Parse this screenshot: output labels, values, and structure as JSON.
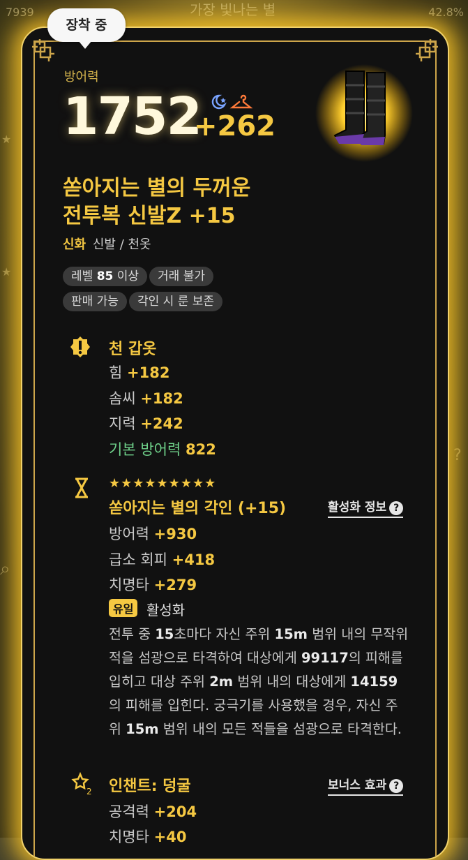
{
  "background": {
    "top_left": "7939",
    "top_center": "가장 빛나는 별",
    "top_right": "42.8%"
  },
  "tag": "장착 중",
  "defense": {
    "label": "방어력",
    "value": "1752",
    "bonus": "+262"
  },
  "item": {
    "name_line1": "쏟아지는 별의 두꺼운",
    "name_line2": "전투복 신발Z +15",
    "grade": "신화",
    "type": "신발 / 천옷",
    "chips": [
      {
        "prefix": "레벨 ",
        "bold": "85",
        "suffix": " 이상"
      },
      {
        "prefix": "거래 불가",
        "bold": "",
        "suffix": ""
      },
      {
        "prefix": "판매 가능",
        "bold": "",
        "suffix": ""
      },
      {
        "prefix": "각인 시 룬 보존",
        "bold": "",
        "suffix": ""
      }
    ]
  },
  "base_section": {
    "title": "천 갑옷",
    "stats": [
      {
        "name": "힘",
        "value": "+182"
      },
      {
        "name": "솜씨",
        "value": "+182"
      },
      {
        "name": "지력",
        "value": "+242"
      },
      {
        "name": "기본 방어력",
        "value": "822"
      }
    ]
  },
  "engrave_section": {
    "stars": "★★★★★★★★★",
    "title": "쏟아지는 별의 각인 (+15)",
    "link": "활성화 정보",
    "stats": [
      {
        "name": "방어력",
        "value": "+930"
      },
      {
        "name": "급소 회피",
        "value": "+418"
      },
      {
        "name": "치명타",
        "value": "+279"
      }
    ],
    "unique_badge": "유일",
    "unique_label": "활성화",
    "description": [
      {
        "t": "전투 중 ",
        "b": false
      },
      {
        "t": "15",
        "b": true
      },
      {
        "t": "초마다 자신 주위 ",
        "b": false
      },
      {
        "t": "15m",
        "b": true
      },
      {
        "t": " 범위 내의 무작위 적을 섬광으로 타격하여 대상에게 ",
        "b": false
      },
      {
        "t": "99117",
        "b": true
      },
      {
        "t": "의 피해를 입히고 대상 주위 ",
        "b": false
      },
      {
        "t": "2m",
        "b": true
      },
      {
        "t": " 범위 내의 대상에게 ",
        "b": false
      },
      {
        "t": "14159",
        "b": true
      },
      {
        "t": "의 피해를 입힌다. 궁극기를 사용했을 경우, 자신 주위 ",
        "b": false
      },
      {
        "t": "15m",
        "b": true
      },
      {
        "t": " 범위 내의 모든 적들을 섬광으로 타격한다.",
        "b": false
      }
    ]
  },
  "enchant_section": {
    "title": "인챈트: 덩굴",
    "link": "보너스 효과",
    "stats": [
      {
        "name": "공격력",
        "value": "+204"
      },
      {
        "name": "치명타",
        "value": "+40"
      }
    ]
  },
  "colors": {
    "accent": "#f5c842",
    "green": "#6fd18a",
    "card_bg": "#111111",
    "glow": "#ffc828"
  },
  "icons": [
    "knot-ornament-icon",
    "moon-star-icon",
    "hanger-icon",
    "boots-icon",
    "armor-shield-icon",
    "engrave-hourglass-icon",
    "enchant-star-icon",
    "question-icon"
  ]
}
